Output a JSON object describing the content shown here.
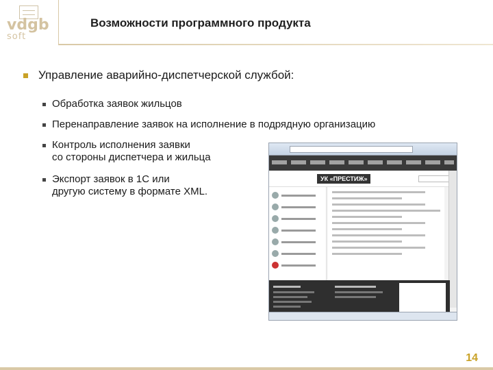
{
  "header": {
    "logo_main": "vdgb",
    "logo_soft": "soft",
    "title": "Возможности программного продукта"
  },
  "content": {
    "main_item": "Управление аварийно-диспетчерской службой:",
    "sub_items": [
      {
        "lines": [
          "Обработка заявок жильцов"
        ]
      },
      {
        "lines": [
          "Перенаправление заявок на исполнение в подрядную организацию"
        ]
      },
      {
        "lines": [
          "Контроль исполнения заявки",
          "со стороны диспетчера и жильца"
        ]
      },
      {
        "lines": [
          "Экспорт заявок в 1С или",
          "другую систему в формате XML."
        ]
      }
    ]
  },
  "screenshot": {
    "site_logo": "УК «ПРЕСТИЖ»"
  },
  "footer": {
    "page_number": "14"
  },
  "colors": {
    "accent": "#c9a227",
    "logo": "#d4c3a1",
    "rule": "#d9c9a6"
  }
}
